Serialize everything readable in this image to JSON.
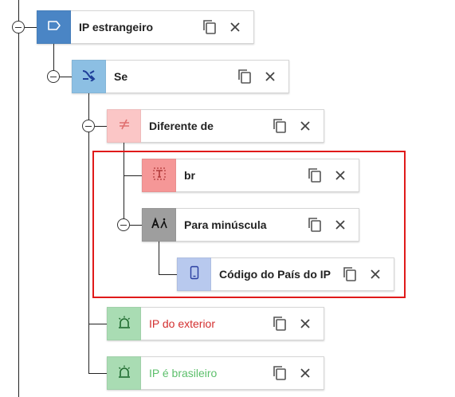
{
  "colors": {
    "rule": "#4a85c5",
    "condition": "#8cbfe3",
    "comparator": "#fbc6c6",
    "text_value": "#f59797",
    "function": "#9e9e9e",
    "variable": "#b8c9ee",
    "action": "#a9dcb3",
    "action_exterior_text": "#d32f2f",
    "action_brasileiro_text": "#5cbf6b",
    "highlight": "#e01a1a"
  },
  "nodes": [
    {
      "id": "rule",
      "label": "IP estrangeiro",
      "icon": "tag-icon",
      "copy_label": "Copiar",
      "remove_label": "Remover"
    },
    {
      "id": "condition",
      "label": "Se",
      "icon": "branch-icon"
    },
    {
      "id": "comparator",
      "label": "Diferente de",
      "icon": "not-equal-icon"
    },
    {
      "id": "text-value",
      "label": "br",
      "icon": "text-icon"
    },
    {
      "id": "lowercase",
      "label": "Para minúscula",
      "icon": "lowercase-icon"
    },
    {
      "id": "country",
      "label": "Código do País do IP",
      "icon": "device-icon"
    },
    {
      "id": "action-exterior",
      "label": "IP do exterior",
      "icon": "alarm-icon"
    },
    {
      "id": "action-brasileiro",
      "label": "IP é brasileiro",
      "icon": "alarm-icon"
    }
  ]
}
